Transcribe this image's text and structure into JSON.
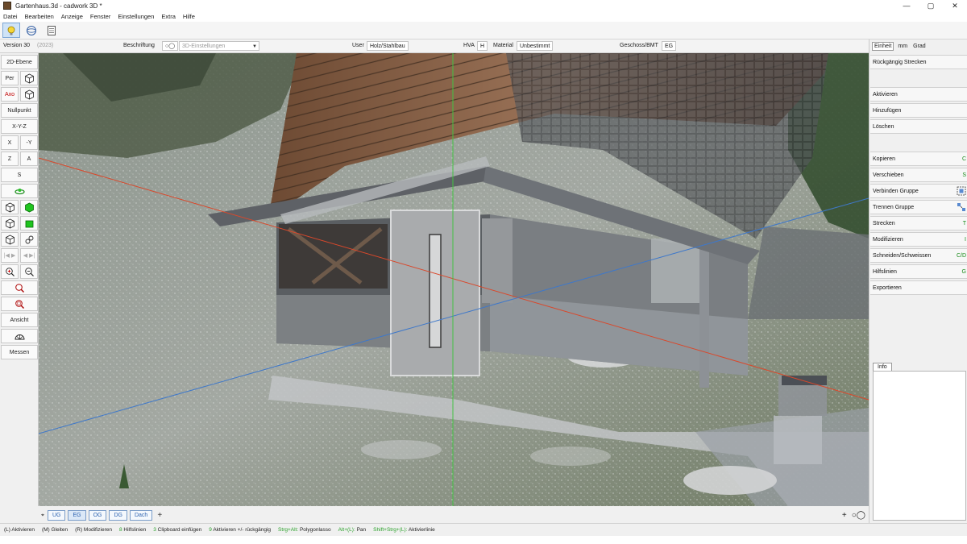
{
  "window": {
    "title": "Gartenhaus.3d - cadwork 3D *",
    "controls": [
      "—",
      "▢",
      "✕"
    ]
  },
  "menu": [
    "Datei",
    "Bearbeiten",
    "Anzeige",
    "Fenster",
    "Einstellungen",
    "Extra",
    "Hilfe"
  ],
  "toolbar": {
    "icons": [
      "light-bulb-icon",
      "sphere-icon",
      "document-icon"
    ]
  },
  "infobar": {
    "version": "Version 30",
    "version_year": "(2023)",
    "beschriftung_label": "Beschriftung",
    "settings_3d": "3D-Einstellungen",
    "user_label": "User",
    "user_value": "Holz/Stahlbau",
    "hva_label": "HVA",
    "hva_value": "H",
    "material_label": "Material",
    "material_value": "Unbestimmt",
    "geschoss_label": "Geschoss/BMT",
    "geschoss_value": "EG"
  },
  "left_tools": {
    "ebene_2d": "2D-Ebene",
    "per": "Per",
    "axo": "Axo",
    "nullpunkt": "Nullpunkt",
    "axes": "X-Y-Z",
    "x": "X",
    "neg_y": "-Y",
    "z": "Z",
    "a": "A",
    "s": "S",
    "ansicht": "Ansicht",
    "messen": "Messen"
  },
  "right_panel": {
    "units_label": "Einheit",
    "unit_mm": "mm",
    "unit_grad": "Grad",
    "undo": "Rückgängig Strecken",
    "aktivieren": "Aktivieren",
    "hinzufuegen": "Hinzufügen",
    "loeschen": "Löschen",
    "kopieren": "Kopieren",
    "kopieren_key": "C",
    "verschieben": "Verschieben",
    "verschieben_key": "S",
    "verbinden": "Verbinden Gruppe",
    "trennen": "Trennen Gruppe",
    "strecken": "Strecken",
    "strecken_key": "T",
    "modifizieren": "Modifizieren",
    "modifizieren_key": "I",
    "schneiden": "Schneiden/Schweissen",
    "schneiden_key": "C/D",
    "hilfslinien": "Hilfslinien",
    "hilfslinien_key": "G",
    "exportieren": "Exportieren",
    "info_tab": "Info"
  },
  "floor_tabs": [
    "UG",
    "EG",
    "OG",
    "DG",
    "Dach"
  ],
  "statusbar": {
    "s1": "(L) Aktivieren",
    "s2": "(M) Gleiten",
    "s3": "(R) Modifizieren",
    "s4_key": "8",
    "s4": "Hilfslinien",
    "s5_key": "3",
    "s5": "Clipboard einfügen",
    "s6_key": "9",
    "s6": "Aktivieren +/- rückgängig",
    "s7_key": "Strg+Alt:",
    "s7": "Polygonlasso",
    "s8_key": "Alt+(L):",
    "s8": "Pan",
    "s9_key": "Shift+Strg+(L):",
    "s9": "Aktivierlinie"
  },
  "colors": {
    "x_axis": "#d9482b",
    "y_axis": "#3f78c9",
    "z_axis": "#43c243",
    "accent": "#2f64b0",
    "key_green": "#2aa12a"
  }
}
